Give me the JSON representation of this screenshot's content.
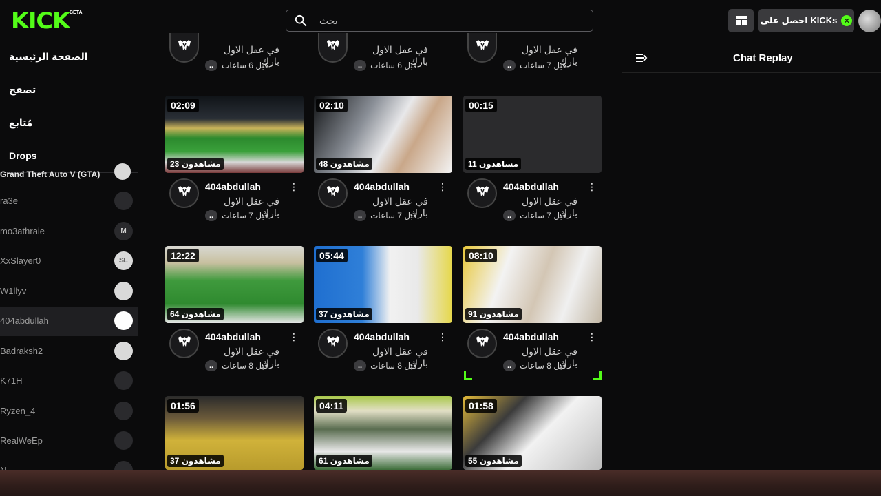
{
  "brand": {
    "logo": "KICK",
    "beta": "BETA",
    "accent": "#53fc18"
  },
  "search": {
    "placeholder": "بحث"
  },
  "header": {
    "kicks_label": "احصل على KICKs"
  },
  "nav": [
    {
      "label": "الصفحة الرئيسية"
    },
    {
      "label": "تصفح"
    },
    {
      "label": "مُتابع"
    },
    {
      "label": "Drops"
    }
  ],
  "channels": [
    {
      "name": "Grand Theft Auto V (GTA)",
      "avatar": ""
    },
    {
      "name": "ra3e",
      "avatar": ""
    },
    {
      "name": "mo3athraie",
      "avatar": "M"
    },
    {
      "name": "XxSlayer0",
      "avatar": "SL"
    },
    {
      "name": "W1llyv",
      "avatar": ""
    },
    {
      "name": "404abdullah",
      "avatar": ""
    },
    {
      "name": "Badraksh2",
      "avatar": ""
    },
    {
      "name": "K71H",
      "avatar": ""
    },
    {
      "name": "Ryzen_4",
      "avatar": ""
    },
    {
      "name": "RealWeEp",
      "avatar": ""
    },
    {
      "name": "N",
      "avatar": ""
    }
  ],
  "chat": {
    "title": "Chat Replay"
  },
  "top_row": [
    {
      "subtitle": "في عقل الاول بارك",
      "time": "قبل 6 ساعات",
      "pill": ".."
    },
    {
      "subtitle": "في عقل الاول بارك",
      "time": "قبل 6 ساعات",
      "pill": ".."
    },
    {
      "subtitle": "في عقل الاول بارك",
      "time": "قبل 7 ساعات",
      "pill": ".."
    }
  ],
  "videos": [
    {
      "duration": "02:09",
      "views": "مشاهدون 23",
      "channel": "404abdullah",
      "subtitle": "في عقل الاول بارك",
      "time": "قبل 7 ساعات",
      "pill": "..",
      "menu": "⋮"
    },
    {
      "duration": "02:10",
      "views": "مشاهدون 48",
      "channel": "404abdullah",
      "subtitle": "في عقل الاول بارك",
      "time": "قبل 7 ساعات",
      "pill": "..",
      "menu": "⋮"
    },
    {
      "duration": "00:15",
      "views": "مشاهدون 11",
      "channel": "404abdullah",
      "subtitle": "في عقل الاول بارك",
      "time": "قبل 7 ساعات",
      "pill": "..",
      "menu": "⋮"
    },
    {
      "duration": "12:22",
      "views": "مشاهدون 64",
      "channel": "404abdullah",
      "subtitle": "في عقل الاول بارك",
      "time": "قبل 8 ساعات",
      "pill": "..",
      "menu": "⋮"
    },
    {
      "duration": "05:44",
      "views": "مشاهدون 37",
      "channel": "404abdullah",
      "subtitle": "في عقل الاول بارك",
      "time": "قبل 8 ساعات",
      "pill": "..",
      "menu": "⋮"
    },
    {
      "duration": "08:10",
      "views": "مشاهدون 91",
      "channel": "404abdullah",
      "subtitle": "في عقل الاول بارك",
      "time": "قبل 8 ساعات",
      "pill": "..",
      "menu": "⋮"
    },
    {
      "duration": "01:56",
      "views": "مشاهدون 37"
    },
    {
      "duration": "04:11",
      "views": "مشاهدون 61"
    },
    {
      "duration": "01:58",
      "views": "مشاهدون 55"
    }
  ]
}
